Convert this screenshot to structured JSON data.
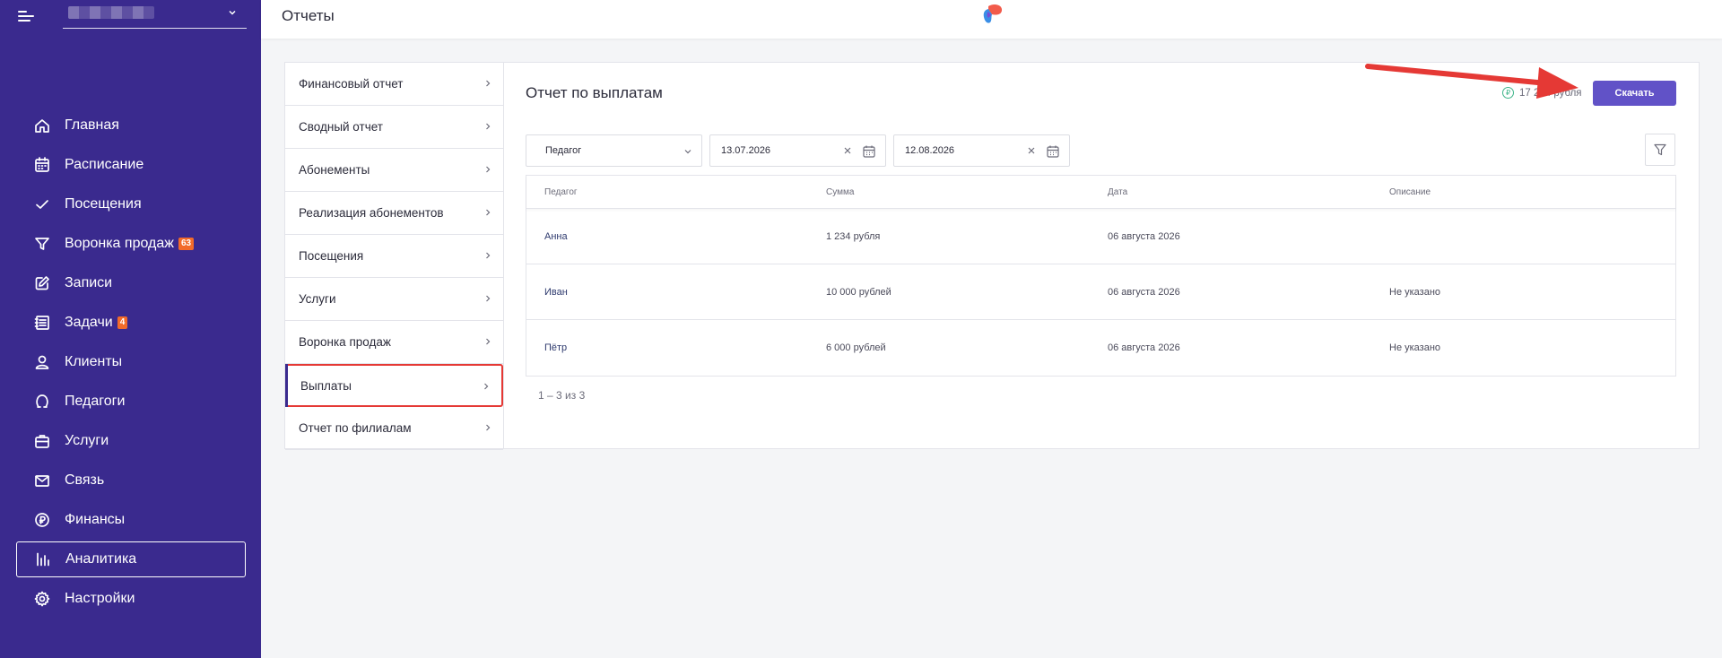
{
  "topbar": {
    "title": "Отчеты"
  },
  "sidebar": {
    "items": [
      {
        "label": "Главная",
        "icon": "home-icon",
        "badge": ""
      },
      {
        "label": "Расписание",
        "icon": "calendar-icon",
        "badge": ""
      },
      {
        "label": "Посещения",
        "icon": "check-icon",
        "badge": ""
      },
      {
        "label": "Воронка продаж",
        "icon": "funnel-icon",
        "badge": "63"
      },
      {
        "label": "Записи",
        "icon": "edit-icon",
        "badge": ""
      },
      {
        "label": "Задачи",
        "icon": "tasks-icon",
        "badge": "4"
      },
      {
        "label": "Клиенты",
        "icon": "user-icon",
        "badge": ""
      },
      {
        "label": "Педагоги",
        "icon": "teacher-icon",
        "badge": ""
      },
      {
        "label": "Услуги",
        "icon": "briefcase-icon",
        "badge": ""
      },
      {
        "label": "Связь",
        "icon": "mail-icon",
        "badge": ""
      },
      {
        "label": "Финансы",
        "icon": "coin-icon",
        "badge": ""
      },
      {
        "label": "Аналитика",
        "icon": "bar-chart-icon",
        "badge": "",
        "active": true
      },
      {
        "label": "Настройки",
        "icon": "gear-icon",
        "badge": ""
      }
    ]
  },
  "menu": {
    "items": [
      "Финансовый отчет",
      "Сводный отчет",
      "Абонементы",
      "Реализация абонементов",
      "Посещения",
      "Услуги",
      "Воронка продаж",
      "Выплаты",
      "Отчет по филиалам"
    ],
    "selected": "Выплаты"
  },
  "report": {
    "title": "Отчет по выплатам",
    "total": "17 234 рубля",
    "download_label": "Скачать",
    "filters": {
      "teacher_placeholder": "Педагог",
      "date_from": "13.07.2026",
      "date_to": "12.08.2026"
    },
    "columns": [
      "Педагог",
      "Сумма",
      "Дата",
      "Описание"
    ],
    "rows": [
      [
        "Анна",
        "1 234 рубля",
        "06 августа 2026",
        ""
      ],
      [
        "Иван",
        "10 000 рублей",
        "06 августа 2026",
        "Не указано"
      ],
      [
        "Пётр",
        "6 000 рублей",
        "06 августа 2026",
        "Не указано"
      ]
    ],
    "pagination": "1 – 3 из 3"
  },
  "colors": {
    "sidebar": "#3a2a8e",
    "accent": "#6152c7",
    "highlight": "#e53935",
    "badge": "#f26b2a"
  }
}
